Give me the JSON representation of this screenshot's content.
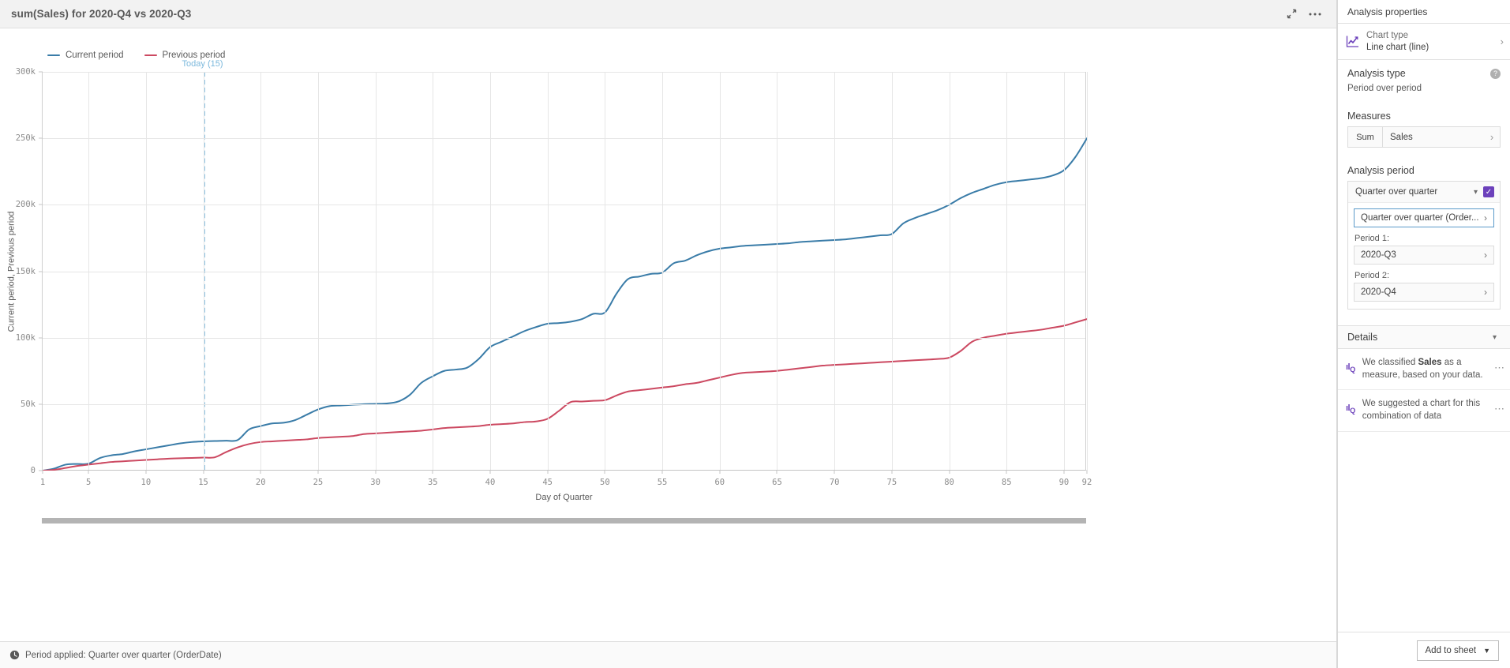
{
  "chart_panel": {
    "title": "sum(Sales) for 2020-Q4 vs 2020-Q3",
    "collapse_icon": "collapse-arrows-icon",
    "more_icon": "ellipsis-icon",
    "footer": {
      "clock_icon": "clock-icon",
      "text": "Period applied:  Quarter over quarter (OrderDate)"
    }
  },
  "properties": {
    "header": "Analysis properties",
    "chart_type": {
      "icon": "line-chart-icon",
      "label": "Chart type",
      "value": "Line chart (line)",
      "chevron": "chevron-right-icon"
    },
    "analysis_type": {
      "title": "Analysis type",
      "help_icon": "help-icon",
      "value": "Period over period"
    },
    "measures": {
      "title": "Measures",
      "aggregation": "Sum",
      "field": "Sales",
      "chevron": "chevron-right-icon"
    },
    "analysis_period": {
      "title": "Analysis period",
      "selected": "Quarter over quarter",
      "dropdown_icon": "chevron-down-icon",
      "checkbox_checked": true,
      "check_icon": "check-icon",
      "definition": "Quarter over quarter (Order...",
      "period1_label": "Period 1:",
      "period1_value": "2020-Q3",
      "period2_label": "Period 2:",
      "period2_value": "2020-Q4"
    },
    "details": {
      "title": "Details",
      "collapse_icon": "chevron-down-icon",
      "items": [
        {
          "icon": "insight-icon",
          "text_before": "We classified ",
          "bold": "Sales",
          "text_after": " as a measure, based on your data.",
          "more_icon": "ellipsis-icon"
        },
        {
          "icon": "insight-icon",
          "text_before": "We suggested a chart for this combination of data",
          "bold": "",
          "text_after": "",
          "more_icon": "ellipsis-icon"
        }
      ]
    },
    "footer": {
      "add_to_sheet": "Add to sheet",
      "caret_icon": "caret-down-icon"
    }
  },
  "chart_data": {
    "type": "line",
    "title": "sum(Sales) for 2020-Q4 vs 2020-Q3",
    "xlabel": "Day of Quarter",
    "ylabel": "Current period, Previous period",
    "grid": true,
    "legend_position": "top-left",
    "xlim": [
      1,
      92
    ],
    "ylim": [
      0,
      300000
    ],
    "xticks": [
      1,
      5,
      10,
      15,
      20,
      25,
      30,
      35,
      40,
      45,
      50,
      55,
      60,
      65,
      70,
      75,
      80,
      85,
      90,
      92
    ],
    "yticks": [
      0,
      50000,
      100000,
      150000,
      200000,
      250000,
      300000
    ],
    "ytick_labels": [
      "0",
      "50k",
      "100k",
      "150k",
      "200k",
      "250k",
      "300k"
    ],
    "annotations": [
      {
        "name": "today-marker",
        "label": "Today (15)",
        "x": 15,
        "color": "#8ec4e3",
        "style": "dashed-vertical"
      }
    ],
    "colors": {
      "current": "#3a7ca8",
      "previous": "#cc4961"
    },
    "series": [
      {
        "name": "Current period",
        "color": "#3a7ca8",
        "x": [
          1,
          2,
          3,
          4,
          5,
          6,
          7,
          8,
          9,
          10,
          11,
          12,
          13,
          14,
          15,
          16,
          17,
          18,
          19,
          20,
          21,
          22,
          23,
          24,
          25,
          26,
          27,
          28,
          29,
          30,
          31,
          32,
          33,
          34,
          35,
          36,
          37,
          38,
          39,
          40,
          41,
          42,
          43,
          44,
          45,
          46,
          47,
          48,
          49,
          50,
          51,
          52,
          53,
          54,
          55,
          56,
          57,
          58,
          59,
          60,
          61,
          62,
          63,
          64,
          65,
          66,
          67,
          68,
          69,
          70,
          71,
          72,
          73,
          74,
          75,
          76,
          77,
          78,
          79,
          80,
          81,
          82,
          83,
          84,
          85,
          86,
          87,
          88,
          89,
          90,
          91,
          92
        ],
        "values": [
          0,
          1500,
          4500,
          5000,
          5200,
          9500,
          11500,
          12500,
          14500,
          16000,
          17500,
          19000,
          20500,
          21500,
          22000,
          22300,
          22500,
          23000,
          31000,
          33500,
          35500,
          36000,
          38000,
          42000,
          46000,
          48500,
          49000,
          49500,
          50000,
          50200,
          50500,
          52000,
          57000,
          66000,
          71000,
          75000,
          76000,
          77500,
          84000,
          93000,
          97000,
          101000,
          105000,
          108000,
          110500,
          111000,
          112000,
          114000,
          118000,
          119000,
          133000,
          144000,
          146000,
          148000,
          149000,
          156000,
          158000,
          162000,
          165000,
          167000,
          168000,
          169000,
          169500,
          170000,
          170500,
          171000,
          172000,
          172500,
          173000,
          173500,
          174000,
          175000,
          176000,
          177000,
          178000,
          186000,
          190000,
          193000,
          196000,
          200000,
          205000,
          209000,
          212000,
          215000,
          217000,
          218000,
          219000,
          220000,
          222000,
          226000,
          236000,
          250000
        ]
      },
      {
        "name": "Previous period",
        "color": "#cc4961",
        "x": [
          1,
          2,
          3,
          4,
          5,
          6,
          7,
          8,
          9,
          10,
          11,
          12,
          13,
          14,
          15,
          16,
          17,
          18,
          19,
          20,
          21,
          22,
          23,
          24,
          25,
          26,
          27,
          28,
          29,
          30,
          31,
          32,
          33,
          34,
          35,
          36,
          37,
          38,
          39,
          40,
          41,
          42,
          43,
          44,
          45,
          46,
          47,
          48,
          49,
          50,
          51,
          52,
          53,
          54,
          55,
          56,
          57,
          58,
          59,
          60,
          61,
          62,
          63,
          64,
          65,
          66,
          67,
          68,
          69,
          70,
          71,
          72,
          73,
          74,
          75,
          76,
          77,
          78,
          79,
          80,
          81,
          82,
          83,
          84,
          85,
          86,
          87,
          88,
          89,
          90,
          91,
          92
        ],
        "values": [
          0,
          600,
          2000,
          3500,
          4500,
          5500,
          6500,
          7000,
          7500,
          8000,
          8500,
          9000,
          9300,
          9500,
          9800,
          10000,
          14000,
          17500,
          20000,
          21500,
          22000,
          22500,
          23000,
          23500,
          24500,
          25000,
          25500,
          26000,
          27500,
          28000,
          28500,
          29000,
          29500,
          30000,
          31000,
          32000,
          32500,
          33000,
          33500,
          34500,
          35000,
          35500,
          36500,
          37000,
          39000,
          45000,
          51500,
          52000,
          52500,
          53000,
          56500,
          59500,
          60500,
          61500,
          62500,
          63500,
          65000,
          66000,
          68000,
          70000,
          72000,
          73500,
          74000,
          74500,
          75000,
          76000,
          77000,
          78000,
          79000,
          79500,
          80000,
          80500,
          81000,
          81500,
          82000,
          82500,
          83000,
          83500,
          84000,
          85000,
          90000,
          97000,
          100000,
          101500,
          103000,
          104000,
          105000,
          106000,
          107500,
          109000,
          111500,
          114000
        ]
      }
    ]
  }
}
